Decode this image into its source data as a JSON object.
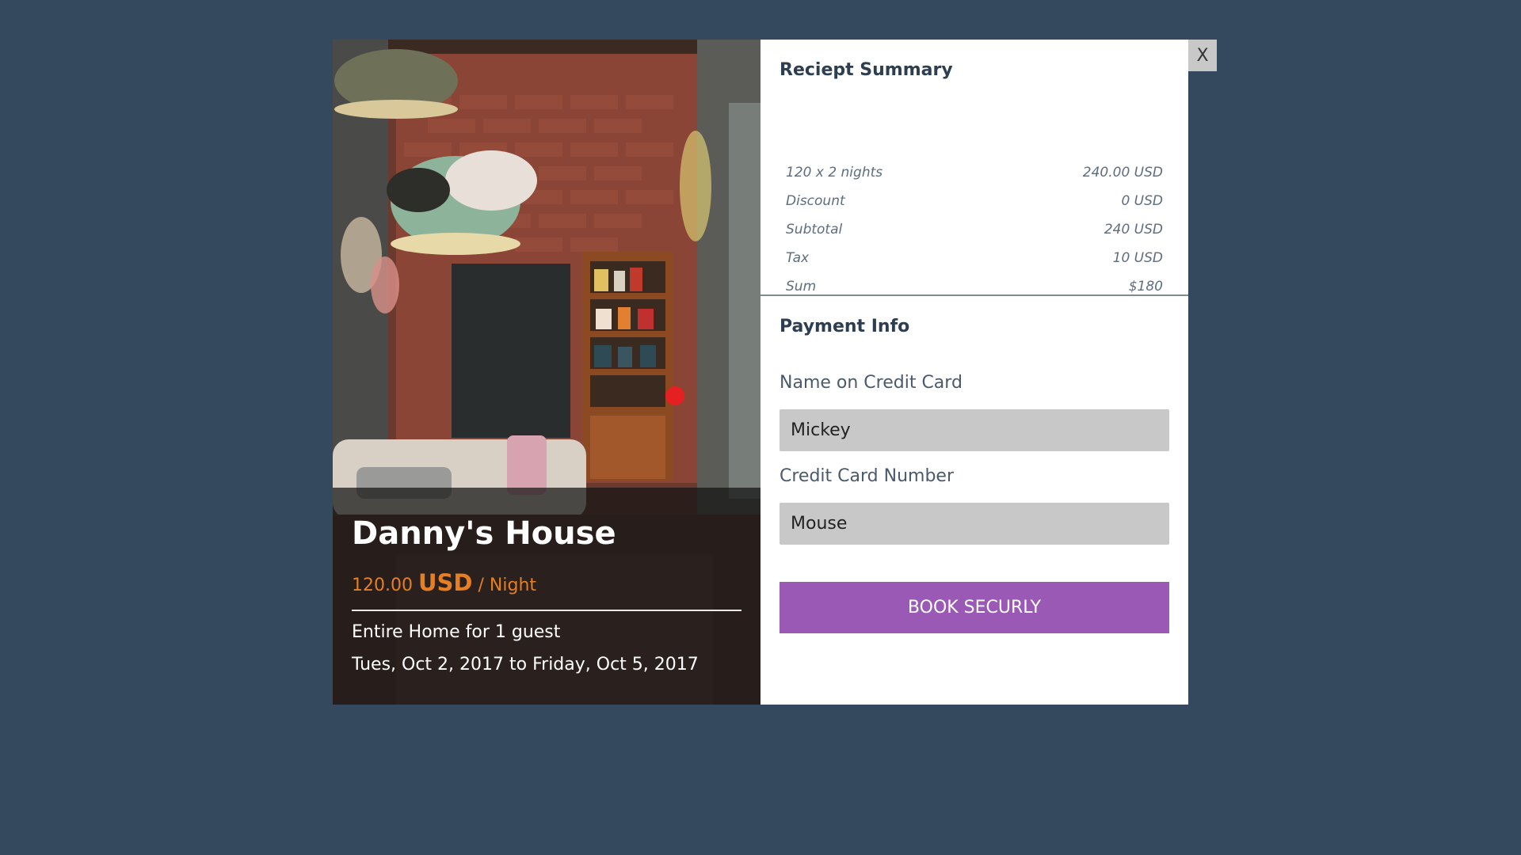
{
  "colors": {
    "page_background": "#34495e",
    "accent_price": "#e67e22",
    "button": "#9b59b6",
    "input_background": "#c8c8c8"
  },
  "listing": {
    "title": "Danny's House",
    "price_amount": "120.00",
    "price_currency": "USD",
    "price_unit": "/ Night",
    "guests": "Entire Home for 1 guest",
    "dates": "Tues, Oct 2, 2017 to Friday, Oct 5, 2017"
  },
  "receipt": {
    "heading": "Reciept Summary",
    "rows": [
      {
        "label": "120 x 2 nights",
        "amount": "240.00 USD"
      },
      {
        "label": "Discount",
        "amount": "0 USD"
      },
      {
        "label": "Subtotal",
        "amount": "240 USD"
      },
      {
        "label": "Tax",
        "amount": "10 USD"
      },
      {
        "label": "Sum",
        "amount": "$180"
      }
    ]
  },
  "payment": {
    "heading": "Payment Info",
    "name_label": "Name on Credit Card",
    "name_value": "Mickey",
    "number_label": "Credit Card Number",
    "number_value": "Mouse",
    "submit_label": "BOOK SECURLY"
  },
  "close_label": "X"
}
